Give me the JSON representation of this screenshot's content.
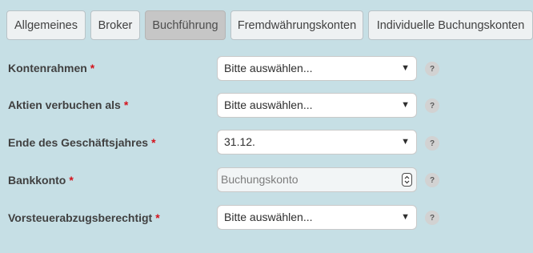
{
  "tabs": [
    {
      "label": "Allgemeines",
      "active": false
    },
    {
      "label": "Broker",
      "active": false
    },
    {
      "label": "Buchführung",
      "active": true
    },
    {
      "label": "Fremdwährungskonten",
      "active": false
    },
    {
      "label": "Individuelle Buchungskonten",
      "active": false
    }
  ],
  "required_marker": "*",
  "help_glyph": "?",
  "dropdown_arrow": "▼",
  "form": {
    "kontenrahmen": {
      "label": "Kontenrahmen",
      "value": "Bitte auswählen..."
    },
    "aktien_verbuchen": {
      "label": "Aktien verbuchen als",
      "value": "Bitte auswählen..."
    },
    "geschaeftsjahr_ende": {
      "label": "Ende des Geschäftsjahres",
      "value": "31.12."
    },
    "bankkonto": {
      "label": "Bankkonto",
      "placeholder": "Buchungskonto"
    },
    "vorsteuer": {
      "label": "Vorsteuerabzugsberechtigt",
      "value": "Bitte auswählen..."
    }
  },
  "colors": {
    "background": "#c6dfe5",
    "required": "#d4121b",
    "active_tab": "#c6c6c6"
  }
}
